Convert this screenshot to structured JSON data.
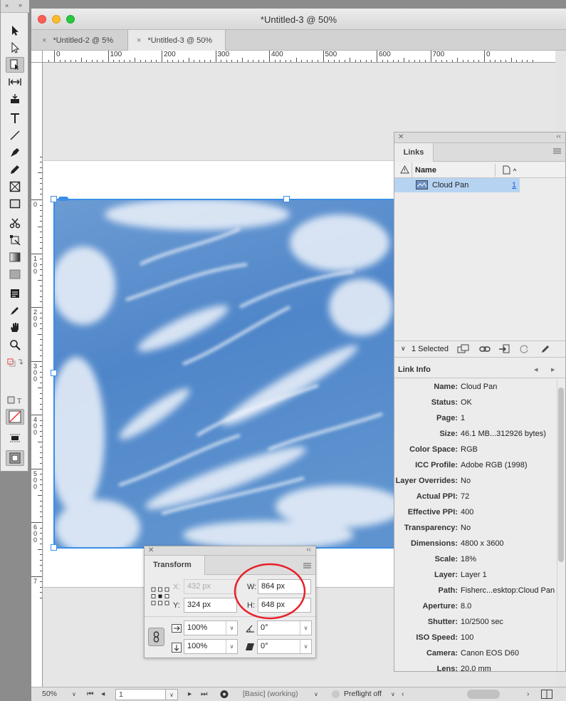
{
  "window": {
    "title": "*Untitled-3 @ 50%"
  },
  "tabs": [
    {
      "label": "*Untitled-2 @ 5%",
      "close": "×"
    },
    {
      "label": "*Untitled-3 @ 50%",
      "close": "×"
    }
  ],
  "tools_panel": {
    "close": "×",
    "collapse": "»"
  },
  "ruler": {
    "h_labels": [
      "0",
      "100",
      "200",
      "300",
      "400",
      "500",
      "600",
      "700",
      "0"
    ],
    "v_labels": [
      "0",
      "1\n0\n0",
      "2\n0\n0",
      "3\n0\n0",
      "4\n0\n0",
      "5\n0\n0",
      "6\n0\n0",
      "7"
    ]
  },
  "links_panel": {
    "title": "Links",
    "col_name": "Name",
    "link_name": "Cloud Pan",
    "link_page": "1",
    "selected": "1 Selected",
    "info_title": "Link Info",
    "info": [
      {
        "k": "Name:",
        "v": "Cloud Pan"
      },
      {
        "k": "Status:",
        "v": "OK"
      },
      {
        "k": "Page:",
        "v": "1"
      },
      {
        "k": "Size:",
        "v": "46.1 MB...312926 bytes)"
      },
      {
        "k": "Color Space:",
        "v": "RGB"
      },
      {
        "k": "ICC Profile:",
        "v": "Adobe RGB (1998)"
      },
      {
        "k": "Layer Overrides:",
        "v": "No"
      },
      {
        "k": "Actual PPI:",
        "v": "72"
      },
      {
        "k": "Effective PPI:",
        "v": "400"
      },
      {
        "k": "Transparency:",
        "v": "No"
      },
      {
        "k": "Dimensions:",
        "v": "4800 x 3600"
      },
      {
        "k": "Scale:",
        "v": "18%"
      },
      {
        "k": "Layer:",
        "v": "Layer 1"
      },
      {
        "k": "Path:",
        "v": "Fisherc...esktop:Cloud Pan"
      },
      {
        "k": "Aperture:",
        "v": "8.0"
      },
      {
        "k": "Shutter:",
        "v": "10/2500 sec"
      },
      {
        "k": "ISO Speed:",
        "v": "100"
      },
      {
        "k": "Camera:",
        "v": "Canon EOS D60"
      },
      {
        "k": "Lens:",
        "v": "20.0 mm"
      }
    ]
  },
  "transform_panel": {
    "title": "Transform",
    "x_label": "X:",
    "x_value": "432 px",
    "y_label": "Y:",
    "y_value": "324 px",
    "w_label": "W:",
    "w_value": "864 px",
    "h_label": "H:",
    "h_value": "648 px",
    "scale_x": "100%",
    "scale_y": "100%",
    "rotate": "0°",
    "shear": "0°"
  },
  "statusbar": {
    "zoom": "50%",
    "page": "1",
    "profile": "[Basic] (working)",
    "preflight": "Preflight off"
  },
  "colors": {
    "selection": "#3a8ee6",
    "annotation_circle": "#e8202a",
    "link_row": "#b7d3f2"
  }
}
